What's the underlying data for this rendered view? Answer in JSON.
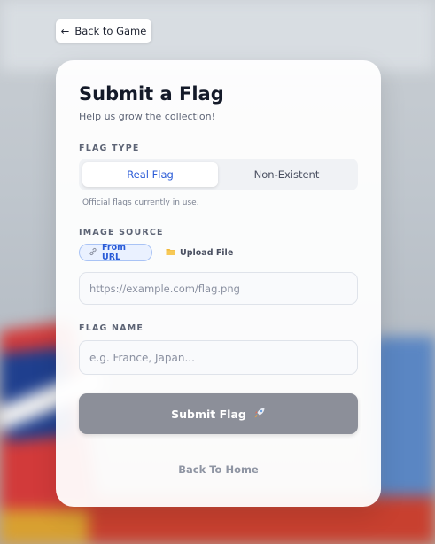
{
  "back_button": {
    "arrow": "←",
    "label": "Back to Game"
  },
  "card": {
    "title": "Submit a Flag",
    "subtitle": "Help us grow the collection!",
    "flag_type": {
      "label": "FLAG TYPE",
      "options": [
        "Real Flag",
        "Non-Existent"
      ],
      "selected": "Real Flag",
      "hint": "Official flags currently in use."
    },
    "image_source": {
      "label": "IMAGE SOURCE",
      "options": [
        {
          "label": "From URL",
          "icon": "link-icon",
          "selected": true
        },
        {
          "label": "Upload File",
          "icon": "folder-icon",
          "selected": false
        }
      ],
      "url_placeholder": "https://example.com/flag.png"
    },
    "flag_name": {
      "label": "FLAG NAME",
      "placeholder": "e.g. France, Japan..."
    },
    "submit_label": "Submit Flag",
    "submit_icon": "rocket-icon",
    "home_link": "Back To Home"
  },
  "colors": {
    "accent": "#2a5bd7",
    "submit_disabled": "#8c8f99",
    "title": "#141a29"
  }
}
